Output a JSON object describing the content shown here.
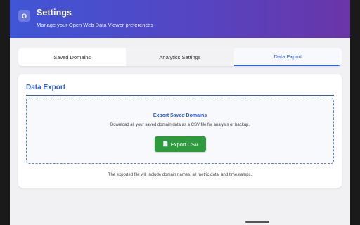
{
  "header": {
    "icon_letter": "O",
    "title": "Settings",
    "subtitle": "Manage your Open Web Data Viewer preferences",
    "gradient_colors": [
      "#3f56d6",
      "#6a35a8"
    ]
  },
  "tabs": [
    {
      "label": "Saved Domains",
      "active": false
    },
    {
      "label": "Analytics Settings",
      "active": false
    },
    {
      "label": "Data Export",
      "active": true
    }
  ],
  "export_card": {
    "title": "Data Export",
    "dropzone_title": "Export Saved Domains",
    "dropzone_description": "Download all your saved domain data as a CSV file for analysis or backup.",
    "button_label": "Export CSV",
    "button_icon": "file-icon",
    "button_color": "#2e9a3e",
    "footnote": "The exported file will include domain names, all metric data, and timestamps."
  },
  "accent_color": "#2f5fd4"
}
